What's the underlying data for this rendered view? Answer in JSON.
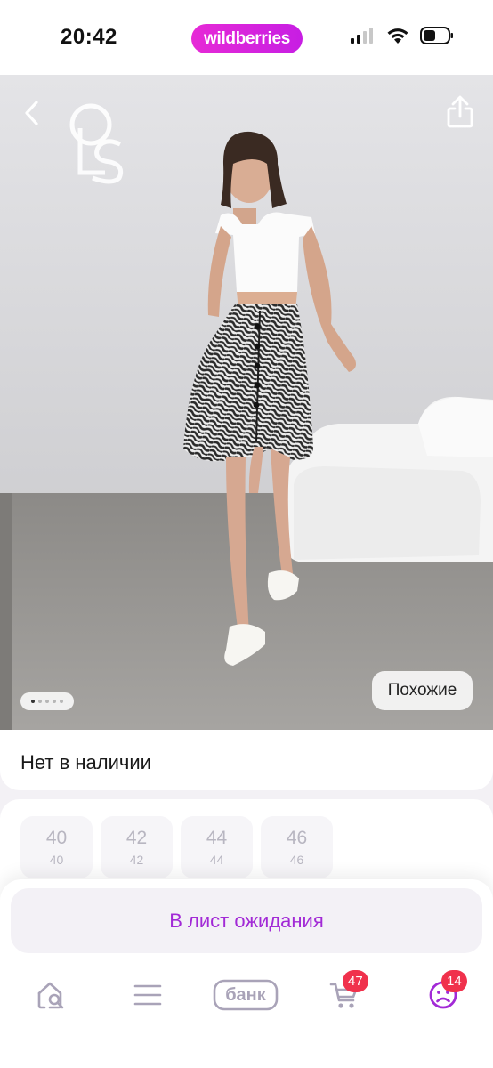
{
  "status_bar": {
    "time": "20:42",
    "brand": "wildberries"
  },
  "product": {
    "image_logo_text": "LS",
    "similar_label": "Похожие",
    "availability": "Нет в наличии",
    "gallery": {
      "total": 5,
      "active_index": 0
    }
  },
  "sizes": [
    {
      "main": "40",
      "sub": "40"
    },
    {
      "main": "42",
      "sub": "42"
    },
    {
      "main": "44",
      "sub": "44"
    },
    {
      "main": "46",
      "sub": "46"
    }
  ],
  "actions": {
    "waitlist_label": "В лист ожидания"
  },
  "tab_bar": {
    "home_icon": "home-search-icon",
    "catalog_icon": "menu-icon",
    "bank_label": "банк",
    "cart_badge": "47",
    "profile_badge": "14"
  },
  "colors": {
    "brand": "#cb11ab",
    "accent_text": "#a22ad6",
    "badge": "#f0314c",
    "tab_icon": "#a9a3b8"
  }
}
